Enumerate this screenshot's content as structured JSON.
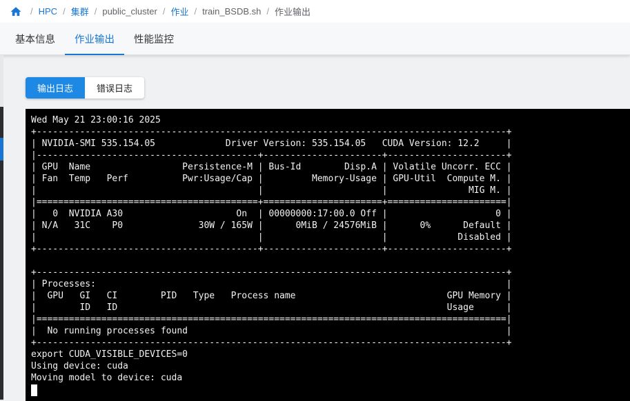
{
  "breadcrumb": {
    "home_icon": "home-icon",
    "items": [
      {
        "label": "HPC",
        "link": true
      },
      {
        "label": "集群",
        "link": true
      },
      {
        "label": "public_cluster",
        "link": false
      },
      {
        "label": "作业",
        "link": true
      },
      {
        "label": "train_BSDB.sh",
        "link": false
      },
      {
        "label": "作业输出",
        "link": false
      }
    ],
    "separator": "/"
  },
  "tabs": [
    {
      "label": "基本信息",
      "active": false
    },
    {
      "label": "作业输出",
      "active": true
    },
    {
      "label": "性能监控",
      "active": false
    }
  ],
  "log_toggle": {
    "output_label": "输出日志",
    "error_label": "错误日志",
    "selected": "output"
  },
  "terminal": {
    "lines": [
      "Wed May 21 23:00:16 2025",
      "+---------------------------------------------------------------------------------------+",
      "| NVIDIA-SMI 535.154.05             Driver Version: 535.154.05   CUDA Version: 12.2     |",
      "|-----------------------------------------+----------------------+----------------------+",
      "| GPU  Name                 Persistence-M | Bus-Id        Disp.A | Volatile Uncorr. ECC |",
      "| Fan  Temp   Perf          Pwr:Usage/Cap |         Memory-Usage | GPU-Util  Compute M. |",
      "|                                         |                      |               MIG M. |",
      "|=========================================+======================+======================|",
      "|   0  NVIDIA A30                     On  | 00000000:17:00.0 Off |                    0 |",
      "| N/A   31C    P0              30W / 165W |      0MiB / 24576MiB |      0%      Default |",
      "|                                         |                      |             Disabled |",
      "+-----------------------------------------+----------------------+----------------------+",
      "",
      "+---------------------------------------------------------------------------------------+",
      "| Processes:                                                                            |",
      "|  GPU   GI   CI        PID   Type   Process name                            GPU Memory |",
      "|        ID   ID                                                             Usage      |",
      "|=======================================================================================|",
      "|  No running processes found                                                           |",
      "+---------------------------------------------------------------------------------------+",
      "export CUDA_VISIBLE_DEVICES=0",
      "Using device: cuda",
      "Moving model to device: cuda"
    ]
  },
  "colors": {
    "accent": "#1976d2",
    "terminal_bg": "#000000",
    "terminal_fg": "#f2f2f2"
  }
}
